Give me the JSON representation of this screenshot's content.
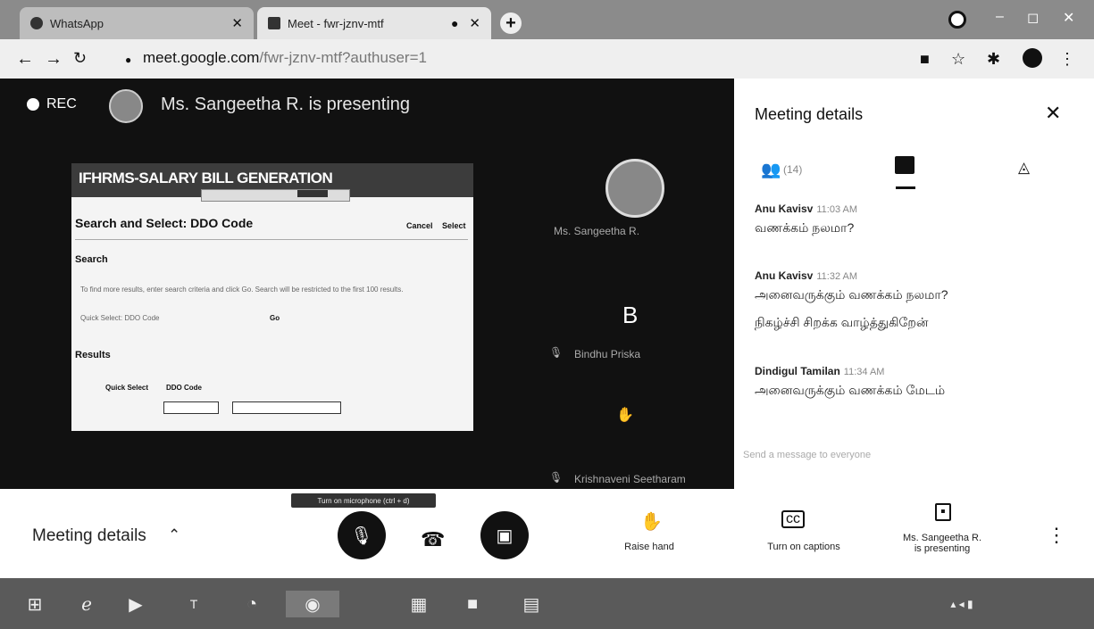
{
  "browser": {
    "tabs": [
      {
        "label": "WhatsApp",
        "active": false
      },
      {
        "label": "Meet - fwr-jznv-mtf",
        "active": true
      }
    ],
    "url": "meet.google.com",
    "url_path": "/fwr-jznv-mtf?authuser=1"
  },
  "stage": {
    "rec_label": "REC",
    "presenter_text": "Ms. Sangeetha R. is presenting"
  },
  "shared_screen": {
    "title": "IFHRMS-SALARY BILL GENERATION",
    "dialog_title": "Search and Select: DDO Code",
    "cancel_label": "Cancel",
    "select_label": "Select",
    "search_label": "Search",
    "search_hint": "To find more results, enter search criteria and click Go. Search will be restricted to the first 100 results.",
    "field_label": "Quick Select: DDO Code",
    "go_label": "Go",
    "results_label": "Results",
    "col_quick_select": "Quick Select",
    "col_ddo_code": "DDO Code"
  },
  "participants": [
    {
      "name": "Ms. Sangeetha R."
    },
    {
      "initial": "B",
      "name": "Bindhu Priska"
    },
    {
      "name": "Krishnaveni Seetharam"
    }
  ],
  "panel": {
    "title": "Meeting details",
    "people_count": "(14)",
    "messages": [
      {
        "sender": "Anu Kavisv",
        "time": "11:03 AM",
        "lines": [
          "வணக்கம் நலமா?"
        ]
      },
      {
        "sender": "Anu Kavisv",
        "time": "11:32 AM",
        "lines": [
          "அனைவருக்கும் வணக்கம் நலமா?",
          "நிகழ்ச்சி சிறக்க வாழ்த்துகிறேன்"
        ]
      },
      {
        "sender": "Dindigul Tamilan",
        "time": "11:34 AM",
        "lines": [
          "அனைவருக்கும் வணக்கம் மேடம்"
        ]
      }
    ],
    "send_placeholder": "Send a message to everyone"
  },
  "bottom": {
    "meeting_details": "Meeting details",
    "tooltip": "Turn on microphone (ctrl + d)",
    "raise_hand": "Raise hand",
    "captions": "Turn on captions",
    "presenting_line1": "Ms. Sangeetha R.",
    "presenting_line2": "is presenting"
  },
  "colors": {
    "stage_bg": "#111111",
    "panel_bg": "#ffffff",
    "control_dark": "#111111"
  }
}
